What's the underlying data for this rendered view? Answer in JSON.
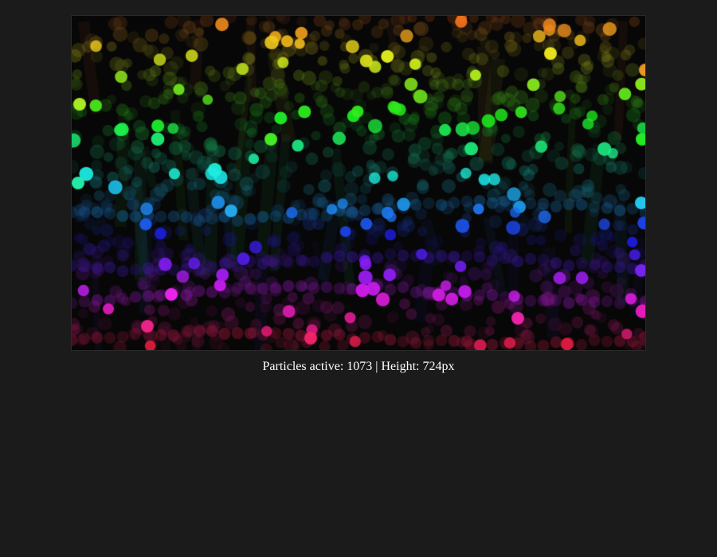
{
  "window": {
    "background": "#1b1b1b"
  },
  "canvas": {
    "background": "#070707"
  },
  "status": {
    "text": "Particles active: 1073 | Height: 724px",
    "color": "#ffffff"
  },
  "visual": {
    "palette_hue_range": [
      0,
      330
    ],
    "bright_particle_alpha": 0.95,
    "dim_particle_alpha": 0.35
  }
}
